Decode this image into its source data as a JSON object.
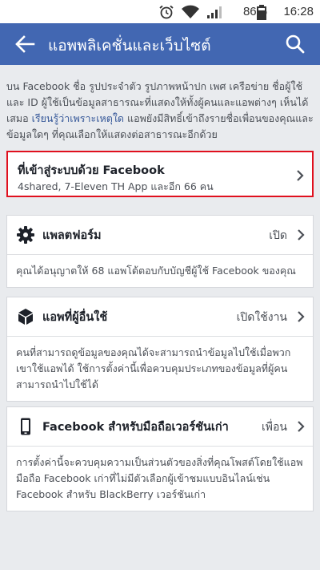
{
  "status_bar": {
    "battery_percent": "86%",
    "time": "16:28",
    "icons": [
      "alarm-icon",
      "wifi-icon",
      "signal-icon",
      "battery-icon"
    ]
  },
  "app_bar": {
    "title": "แอพพลิเคชั่นและเว็บไซต์",
    "back_icon": "arrow-left-icon",
    "search_icon": "search-icon",
    "color": "#4267b2"
  },
  "intro": {
    "text_before": "บน Facebook ชื่อ รูปประจำตัว รูปภาพหน้าปก เพศ เครือข่าย ชื่อผู้ใช้และ ID ผู้ใช้เป็นข้อมูลสาธารณะที่แสดงให้ทั้งผู้คนและแอพต่างๆ เห็นได้เสมอ ",
    "link": "เรียนรู้ว่าเพราะเหตุใด",
    "text_after": " แอพยังมีสิทธิ์เข้าถึงรายชื่อเพื่อนของคุณและข้อมูลใดๆ ที่คุณเลือกให้แสดงต่อสาธารณะอีกด้วย"
  },
  "login_card": {
    "title": "ที่เข้าสู่ระบบด้วย Facebook",
    "subtitle": "4shared, 7-Eleven TH App และอีก 66 คน",
    "highlight_color": "#e0101e"
  },
  "platform_card": {
    "label": "แพลตฟอร์ม",
    "value": "เปิด",
    "icon": "gear-icon",
    "description": "คุณได้อนุญาตให้ 68 แอพโต้ตอบกับบัญชีผู้ใช้ Facebook ของคุณ"
  },
  "others_apps_card": {
    "label": "แอพที่ผู้อื่นใช้",
    "value": "เปิดใช้งาน",
    "icon": "cube-icon",
    "description": "คนที่สามารถดูข้อมูลของคุณได้จะสามารถนำข้อมูลไปใช้เมื่อพวกเขาใช้แอพได้ ใช้การตั้งค่านี้เพื่อควบคุมประเภทของข้อมูลที่ผู้คนสามารถนำไปใช้ได้"
  },
  "old_mobile_card": {
    "label": "Facebook สำหรับมือถือเวอร์ชันเก่า",
    "value": "เพื่อน",
    "icon": "phone-icon",
    "description": "การตั้งค่านี้จะควบคุมความเป็นส่วนตัวของสิ่งที่คุณโพสต์โดยใช้แอพมือถือ Facebook เก่าที่ไม่มีตัวเลือกผู้เข้าชมแบบอินไลน์เช่น Facebook สำหรับ BlackBerry เวอร์ชันเก่า"
  }
}
